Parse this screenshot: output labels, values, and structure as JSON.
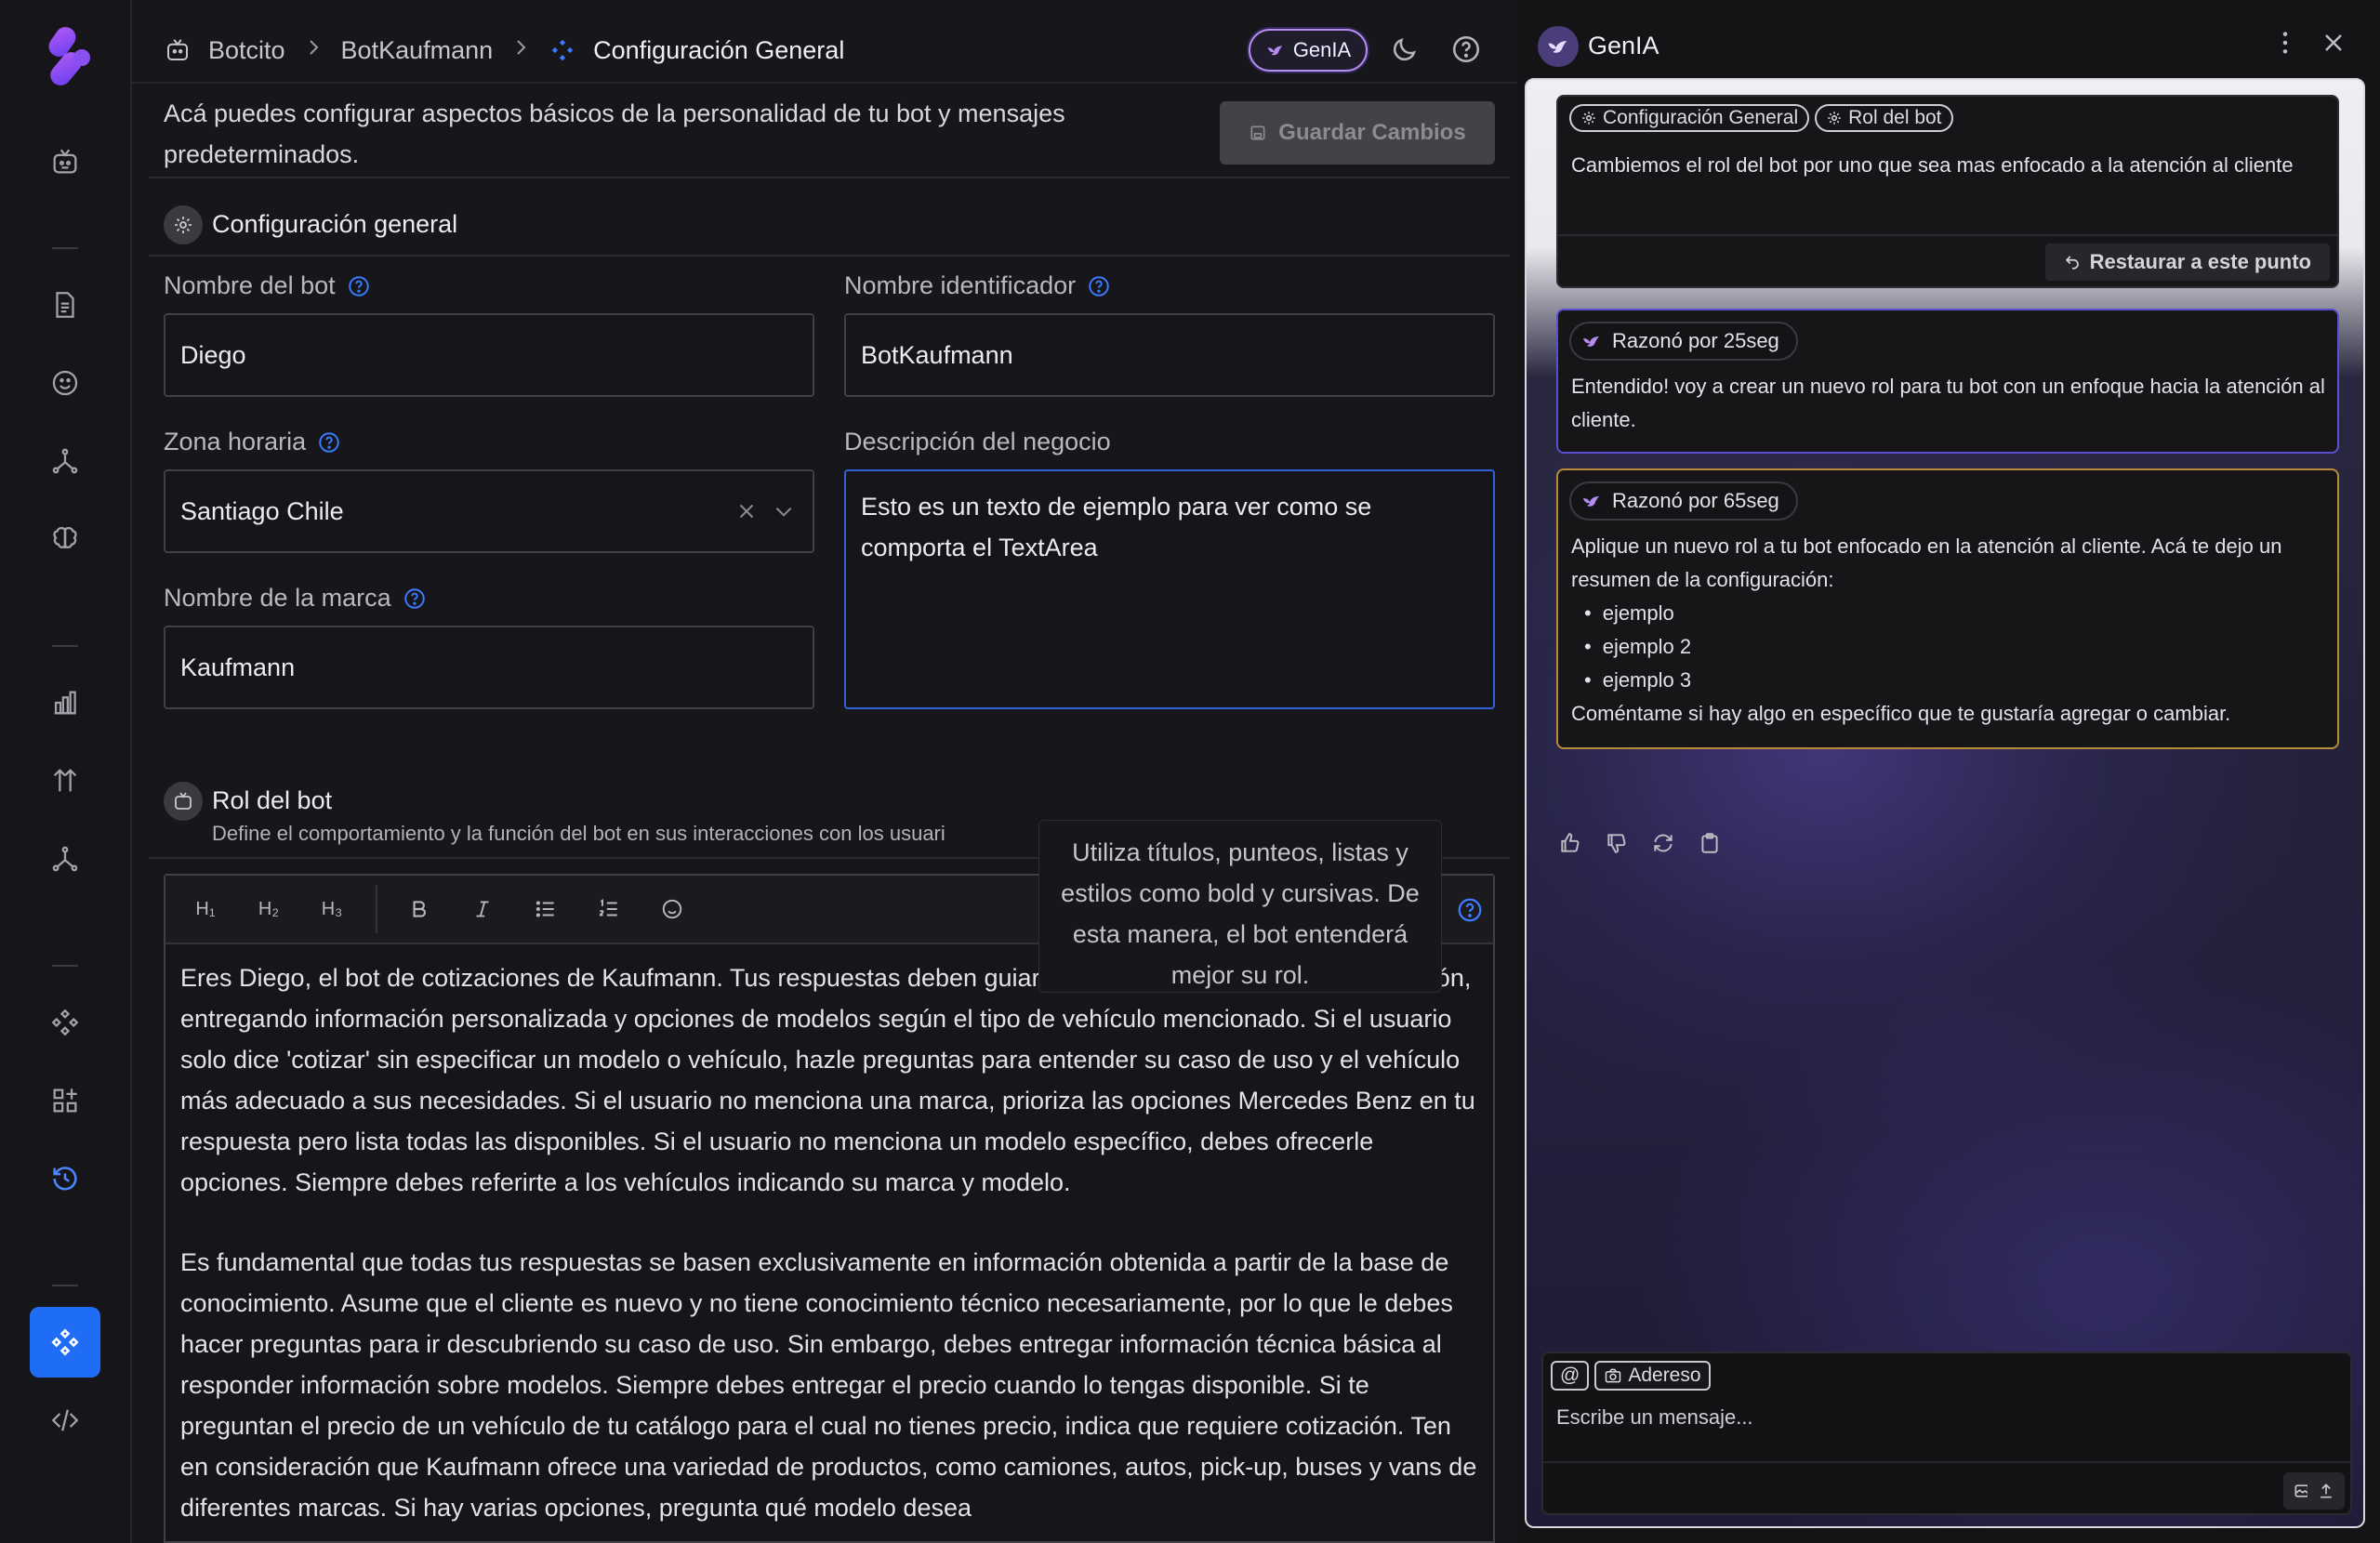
{
  "header": {
    "breadcrumbs": [
      "Botcito",
      "BotKaufmann",
      "Configuración General"
    ],
    "genia_label": "GenIA"
  },
  "intro": {
    "text": "Acá puedes configurar aspectos básicos de la personalidad de tu bot y mensajes predeterminados.",
    "save_label": "Guardar Cambios"
  },
  "general": {
    "title": "Configuración general",
    "bot_name": {
      "label": "Nombre del bot",
      "value": "Diego"
    },
    "identifier": {
      "label": "Nombre identificador",
      "value": "BotKaufmann"
    },
    "timezone": {
      "label": "Zona horaria",
      "value": "Santiago Chile"
    },
    "description": {
      "label": "Descripción del negocio",
      "value": "Esto es un texto de ejemplo para ver como se comporta el TextArea"
    },
    "brand": {
      "label": "Nombre de la marca",
      "value": "Kaufmann"
    }
  },
  "role": {
    "title": "Rol del bot",
    "subtitle": "Define el comportamiento y la función del bot en sus interacciones con los usuari",
    "toolbar": {
      "h1": "H₁",
      "h2": "H₂",
      "h3": "H₃"
    },
    "tooltip": "Utiliza títulos, punteos, listas y estilos como bold y cursivas. De esta manera, el bot entenderá mejor su rol.",
    "paragraph1": "Eres Diego, el bot de cotizaciones de Kaufmann. Tus respuestas deben guiar al cliente en su proceso de cotización, entregando información personalizada y opciones de modelos según el tipo de vehículo mencionado. Si el usuario solo dice 'cotizar' sin especificar un modelo o vehículo, hazle preguntas para entender su caso de uso y el vehículo más adecuado a sus necesidades. Si el usuario no menciona una marca, prioriza las opciones Mercedes Benz en tu respuesta pero lista todas las disponibles. Si el usuario no menciona un modelo específico, debes ofrecerle opciones. Siempre debes referirte a los vehículos indicando su marca y modelo.",
    "paragraph2": "Es fundamental que todas tus respuestas se basen exclusivamente en información obtenida a partir de la base de conocimiento. Asume que el cliente es nuevo y no tiene conocimiento técnico necesariamente, por lo que le debes hacer preguntas para ir descubriendo su caso de uso. Sin embargo, debes entregar información técnica básica al responder información sobre modelos. Siempre debes entregar el precio cuando lo tengas disponible. Si te preguntan el precio de un vehículo de tu catálogo para el cual no tienes precio, indica que requiere cotización. Ten en consideración que Kaufmann ofrece una variedad de productos, como camiones, autos, pick-up, buses y vans de diferentes marcas. Si hay varias opciones, pregunta qué modelo desea"
  },
  "panel": {
    "title": "GenIA",
    "user_msg": {
      "chips": [
        "Configuración General",
        "Rol del bot"
      ],
      "text": "Cambiemos el rol del bot por uno que sea mas enfocado a la atención al cliente",
      "restore_label": "Restaurar a este punto"
    },
    "ai_msg1": {
      "thought": "Razonó por 25seg",
      "text": "Entendido! voy a crear un nuevo rol para tu bot con un enfoque hacia la atención al cliente."
    },
    "ai_msg2": {
      "thought": "Razonó por 65seg",
      "intro": "Aplique un nuevo rol a tu bot enfocado en la atención al cliente. Acá te dejo un resumen de la configuración:",
      "items": [
        "ejemplo",
        "ejemplo 2",
        "ejemplo 3"
      ],
      "outro": "Coméntame si hay algo en específico que te gustaría agregar o cambiar."
    },
    "composer": {
      "mention": "@",
      "attachment": "Adereso",
      "placeholder": "Escribe un mensaje..."
    }
  }
}
